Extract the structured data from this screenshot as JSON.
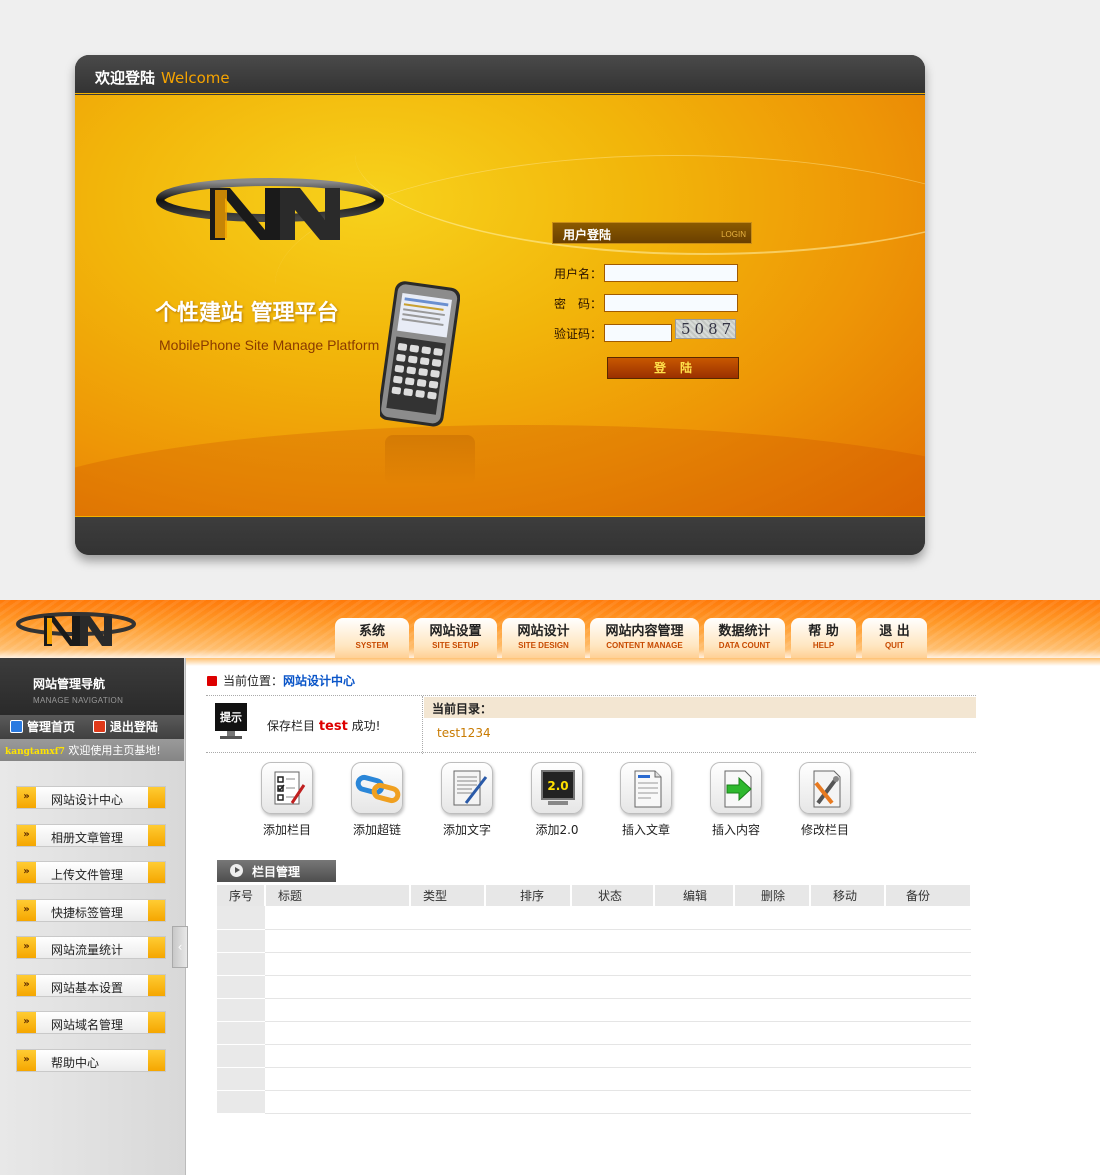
{
  "login": {
    "header_zh": "欢迎登陆",
    "header_en": "Welcome",
    "slogan_zh": "个性建站  管理平台",
    "slogan_en": "MobilePhone Site Manage Platform",
    "form_title": "用户登陆",
    "form_title_sub": "LOGIN",
    "username_label": "用户名：",
    "password_label": "密　码：",
    "captcha_label": "验证码：",
    "username_value": "",
    "password_value": "",
    "captcha_value": "",
    "captcha_image_text": "5087",
    "submit_label": "登陆"
  },
  "nav": {
    "tabs": [
      {
        "zh": "系统",
        "en": "SYSTEM"
      },
      {
        "zh": "网站设置",
        "en": "SITE SETUP"
      },
      {
        "zh": "网站设计",
        "en": "SITE DESIGN"
      },
      {
        "zh": "网站内容管理",
        "en": "CONTENT MANAGE"
      },
      {
        "zh": "数据统计",
        "en": "DATA COUNT"
      },
      {
        "zh": "帮 助",
        "en": "HELP"
      },
      {
        "zh": "退 出",
        "en": "QUIT"
      }
    ]
  },
  "sidebar": {
    "title_zh": "网站管理导航",
    "title_en": "MANAGE NAVIGATION",
    "home_link": "管理首页",
    "logout_link": "退出登陆",
    "username": "kangtamxf7",
    "welcome": "欢迎使用主页基地!",
    "menu": [
      {
        "label": "网站设计中心"
      },
      {
        "label": "相册文章管理"
      },
      {
        "label": "上传文件管理"
      },
      {
        "label": "快捷标签管理"
      },
      {
        "label": "网站流量统计"
      },
      {
        "label": "网站基本设置"
      },
      {
        "label": "网站域名管理"
      },
      {
        "label": "帮助中心"
      }
    ],
    "collapse_glyph": "‹",
    "menu_glyph": "»"
  },
  "main": {
    "crumb_label": "当前位置：",
    "crumb_current": "网站设计中心",
    "tip_badge": "提示",
    "tip_prefix": "保存栏目 ",
    "tip_highlight": "test",
    "tip_suffix": " 成功!",
    "current_dir_label": "当前目录：",
    "current_dir_value": "test1234",
    "tools": [
      {
        "label": "添加栏目",
        "icon": "checklist-icon"
      },
      {
        "label": "添加超链",
        "icon": "chain-link-icon"
      },
      {
        "label": "添加文字",
        "icon": "document-pen-icon"
      },
      {
        "label": "添加2.0",
        "icon": "monitor-2-0-icon"
      },
      {
        "label": "插入文章",
        "icon": "article-icon"
      },
      {
        "label": "插入内容",
        "icon": "green-arrow-icon"
      },
      {
        "label": "修改栏目",
        "icon": "tools-icon"
      }
    ],
    "section_title": "栏目管理",
    "table_headers": [
      "序号",
      "标题",
      "类型",
      "排序",
      "状态",
      "编辑",
      "删除",
      "移动",
      "备份"
    ],
    "table_rows": 9
  },
  "colors": {
    "accent_orange": "#f5a300",
    "link_blue": "#0a55c8",
    "alert_red": "#dd0000"
  }
}
